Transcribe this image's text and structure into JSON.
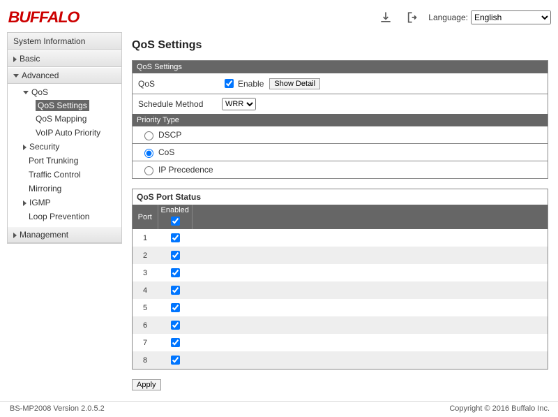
{
  "header": {
    "logo": "BUFFALO",
    "language_label": "Language:",
    "language_value": "English"
  },
  "sidebar": {
    "title": "System Information",
    "sections": {
      "basic": "Basic",
      "advanced": "Advanced",
      "management": "Management"
    },
    "advanced": {
      "qos": "QoS",
      "qos_children": {
        "settings": "QoS Settings",
        "mapping": "QoS Mapping",
        "voip": "VoIP Auto Priority"
      },
      "security": "Security",
      "port_trunking": "Port Trunking",
      "traffic_control": "Traffic Control",
      "mirroring": "Mirroring",
      "igmp": "IGMP",
      "loop_prevention": "Loop Prevention"
    }
  },
  "main": {
    "title": "QoS Settings",
    "panel1": {
      "bar": "QoS Settings",
      "qos_label": "QoS",
      "enable_label": "Enable",
      "show_detail": "Show Detail",
      "schedule_label": "Schedule Method",
      "schedule_value": "WRR",
      "priority_bar": "Priority Type",
      "opt_dscp": "DSCP",
      "opt_cos": "CoS",
      "opt_ipp": "IP Precedence"
    },
    "panel2": {
      "title": "QoS Port Status",
      "th_port": "Port",
      "th_enabled": "Enabled",
      "ports": [
        {
          "port": "1",
          "enabled": true
        },
        {
          "port": "2",
          "enabled": true
        },
        {
          "port": "3",
          "enabled": true
        },
        {
          "port": "4",
          "enabled": true
        },
        {
          "port": "5",
          "enabled": true
        },
        {
          "port": "6",
          "enabled": true
        },
        {
          "port": "7",
          "enabled": true
        },
        {
          "port": "8",
          "enabled": true
        }
      ]
    },
    "apply": "Apply"
  },
  "footer": {
    "version": "BS-MP2008 Version 2.0.5.2",
    "copyright": "Copyright © 2016 Buffalo Inc."
  }
}
